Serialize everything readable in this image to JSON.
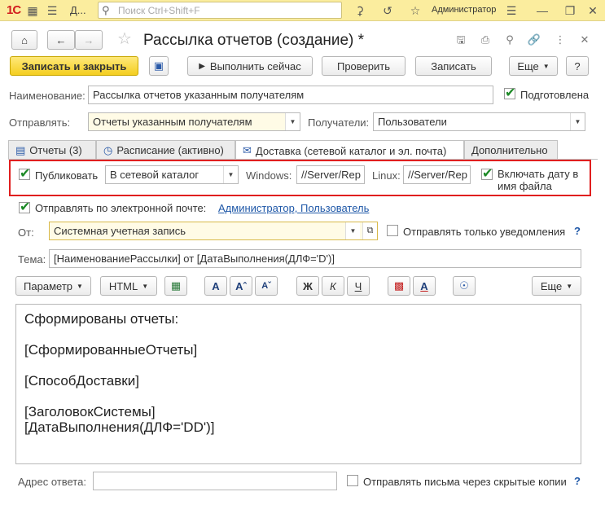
{
  "topbar": {
    "logo": "1С",
    "app_name": "Д...",
    "search_placeholder": "Поиск Ctrl+Shift+F",
    "user": "Администратор"
  },
  "window": {
    "title": "Рассылка отчетов (создание) *"
  },
  "toolbar": {
    "save_close": "Записать и закрыть",
    "run_now": "Выполнить сейчас",
    "check": "Проверить",
    "save": "Записать",
    "more": "Еще",
    "help": "?"
  },
  "form": {
    "name_label": "Наименование:",
    "name_value": "Рассылка отчетов указанным получателям",
    "prepared_label": "Подготовлена",
    "send_label": "Отправлять:",
    "send_value": "Отчеты указанным получателям",
    "recipients_label": "Получатели:",
    "recipients_value": "Пользователи"
  },
  "tabs": [
    {
      "label": "Отчеты (3)"
    },
    {
      "label": "Расписание (активно)"
    },
    {
      "label": "Доставка (сетевой каталог и эл. почта)"
    },
    {
      "label": "Дополнительно"
    }
  ],
  "delivery": {
    "publish_label": "Публиковать",
    "publish_value": "В сетевой каталог",
    "windows_label": "Windows:",
    "windows_value": "//Server/Rep",
    "linux_label": "Linux:",
    "linux_value": "//Server/Rep",
    "include_date_line1": "Включать дату в",
    "include_date_line2": "имя файла",
    "email_label": "Отправлять по электронной почте:",
    "email_recipients": "Администратор, Пользователь",
    "from_label": "От:",
    "from_value": "Системная учетная запись",
    "notify_only_label": "Отправлять только уведомления",
    "subject_label": "Тема:",
    "subject_value": "[НаименованиеРассылки] от [ДатаВыполнения(ДЛФ='D')]",
    "reply_label": "Адрес ответа:",
    "reply_value": "",
    "bcc_label": "Отправлять письма через скрытые копии"
  },
  "editor_toolbar": {
    "param": "Параметр",
    "html": "HTML",
    "bold": "Ж",
    "italic": "К",
    "underline": "Ч",
    "font_a": "A",
    "more": "Еще"
  },
  "editor": {
    "lines": [
      "Сформированы отчеты:",
      "",
      "[СформированныеОтчеты]",
      "",
      "[СпособДоставки]",
      "",
      "[ЗаголовокСистемы]",
      "[ДатаВыполнения(ДЛФ='DD')]"
    ]
  },
  "colors": {
    "accent_yellow": "#f4ce20",
    "link_blue": "#1f58a8",
    "highlight_red": "#e01f1f",
    "check_green": "#1d8a27"
  }
}
